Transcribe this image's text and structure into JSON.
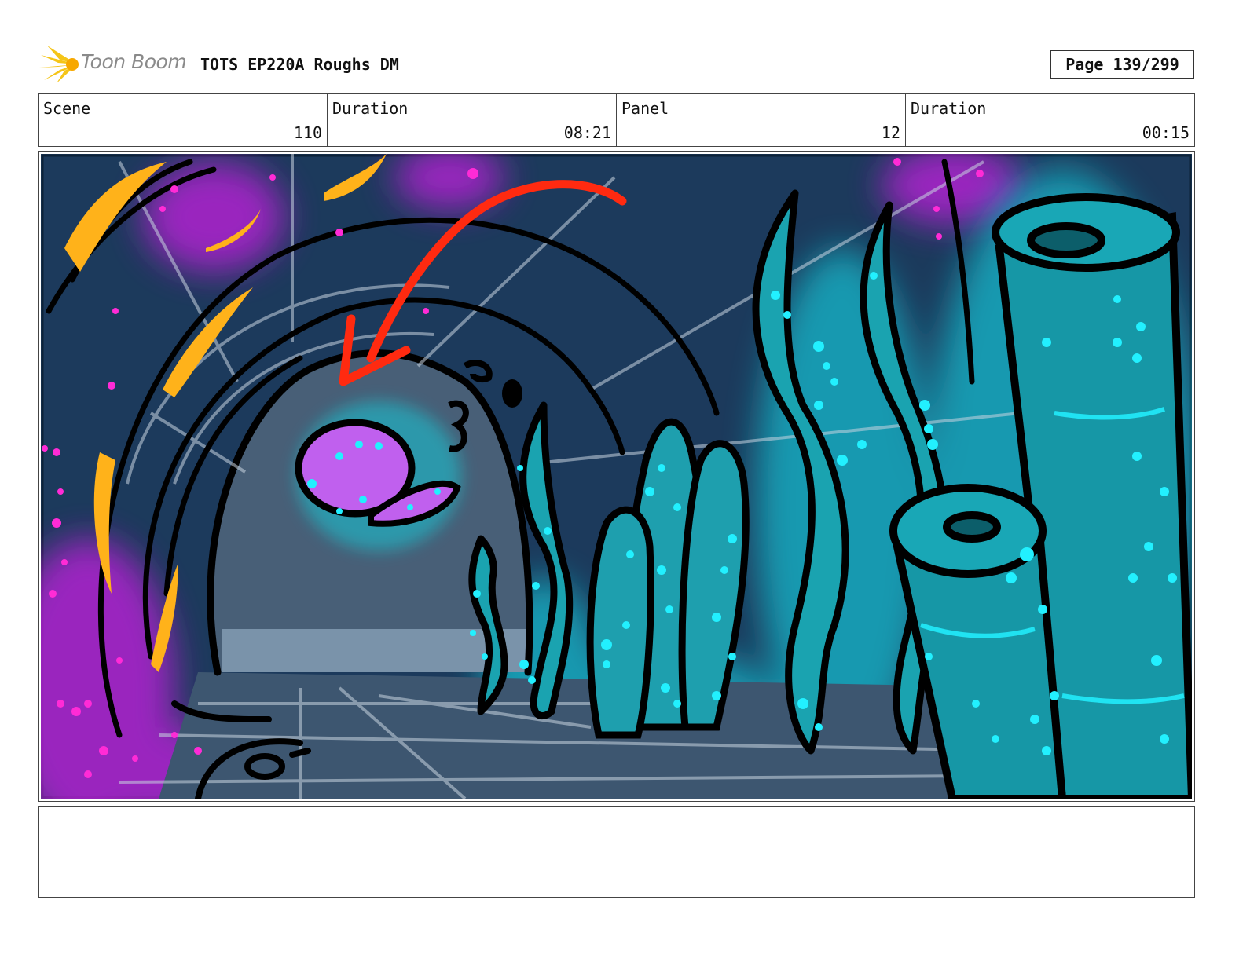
{
  "header": {
    "logo_text": "Toon Boom",
    "title": "TOTS EP220A Roughs DM",
    "page": "Page 139/299"
  },
  "info": {
    "scene_label": "Scene",
    "scene_value": "110",
    "scene_duration_label": "Duration",
    "scene_duration_value": "08:21",
    "panel_label": "Panel",
    "panel_value": "12",
    "panel_duration_label": "Duration",
    "panel_duration_value": "00:15"
  },
  "notes": {
    "text": ""
  },
  "colors": {
    "background_navy": "#1c3a5c",
    "arch_interior": "#4a6078",
    "glow_cyan": "#12c8d8",
    "kelp_teal": "#1aa3b0",
    "bubble_cyan": "#22f0ff",
    "magenta": "#c02bd6",
    "orange": "#ffb21a",
    "arrow_red": "#ff2a10",
    "egg_purple": "#c060ee",
    "logo_yellow": "#f5c518"
  },
  "icons": {
    "logo": "toon-boom-starburst-icon",
    "arrow": "direction-arrow"
  }
}
